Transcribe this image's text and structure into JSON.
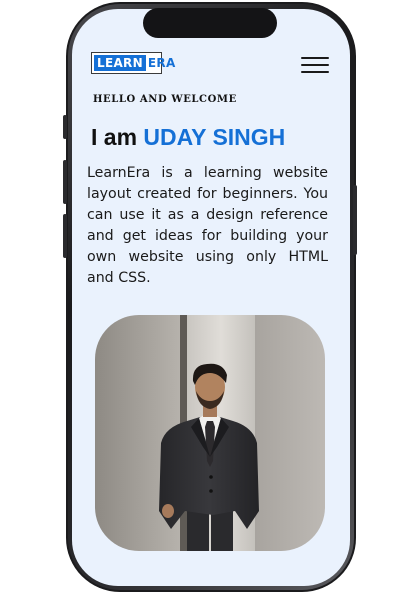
{
  "header": {
    "logo": {
      "part1": "LEARN",
      "part2": "ERA"
    },
    "menu_icon": "hamburger-menu-icon"
  },
  "hero": {
    "greeting": "HELLO AND WELCOME",
    "headline_prefix": "I am ",
    "headline_name": "UDAY SINGH",
    "description": "LearnEra is a learning website layout created for beginners. You can use it as a design reference and get ideas for building your own website using only HTML and CSS."
  },
  "colors": {
    "accent": "#1570d6",
    "screen_background": "#eaf2fd",
    "text": "#111111"
  }
}
